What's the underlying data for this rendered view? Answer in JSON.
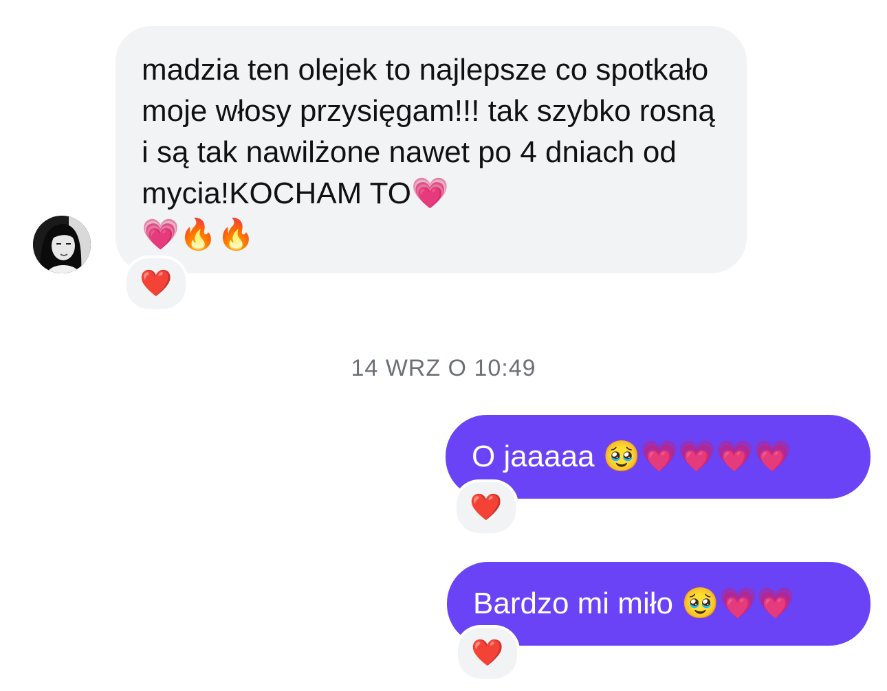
{
  "conversation": {
    "incoming_message": {
      "text": "madzia ten olejek to najlepsze co spotkało moje włosy przysięgam!!! tak szybko rosną i są tak nawilżone nawet po 4 dniach od mycia!KOCHAM TO💗\n💗🔥🔥",
      "reaction": "❤️"
    },
    "timestamp": "14 WRZ O 10:49",
    "outgoing_messages": [
      {
        "text": "O jaaaaa 🥹💗💗💗💗",
        "reaction": "❤️"
      },
      {
        "text": "Bardzo mi miło 🥹💗💗",
        "reaction": "❤️"
      }
    ]
  },
  "colors": {
    "incoming_bubble": "#f2f3f5",
    "outgoing_bubble": "#6a43f6",
    "timestamp_text": "#6b6f76"
  }
}
